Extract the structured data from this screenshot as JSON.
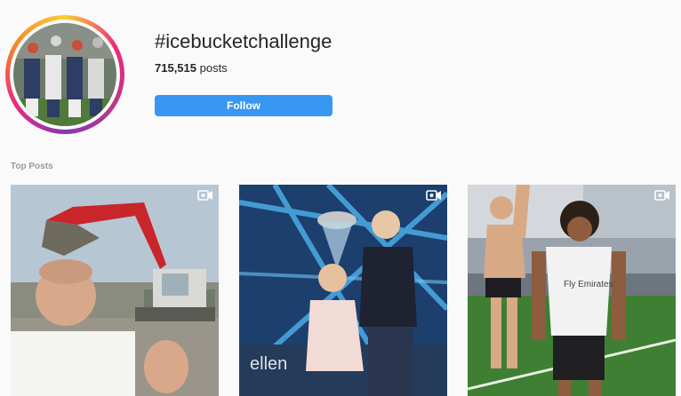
{
  "hashtag": {
    "title": "#icebucketchallenge",
    "post_count": "715,515",
    "post_count_suffix": " posts",
    "follow_label": "Follow"
  },
  "top_posts": {
    "label": "Top Posts",
    "items": [
      {
        "type": "video",
        "icon": "video-camera-icon"
      },
      {
        "type": "video",
        "icon": "video-camera-icon",
        "watermark": "ellen"
      },
      {
        "type": "video",
        "icon": "video-camera-icon",
        "jersey_text": "Fly Emirates"
      }
    ]
  },
  "colors": {
    "accent": "#3897f0",
    "background": "#fafafa"
  }
}
